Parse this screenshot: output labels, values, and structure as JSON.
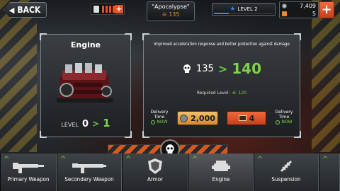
{
  "header": {
    "back_label": "BACK",
    "fuel_bars": 5,
    "car_name": "\"Apocalypse\"",
    "car_power": "135",
    "level_label": "LEVEL 2",
    "level_progress": 0.25,
    "coins": "7,409",
    "gold": "5"
  },
  "part": {
    "title": "Engine",
    "level_label": "LEVEL",
    "level_from": "0",
    "level_to": "1"
  },
  "upgrade": {
    "description": "Improved acceleration response and better protection against damage",
    "power_from": "135",
    "power_to": "140",
    "required_label": "Required Level:",
    "required_value": "120",
    "delivery_label": "Delivery Time",
    "delivery_value": "NOW",
    "price_coins": "2,000",
    "price_gold": "4"
  },
  "tabs": [
    {
      "label": "Primary Weapon"
    },
    {
      "label": "Secondary Weapon"
    },
    {
      "label": "Armor"
    },
    {
      "label": "Engine"
    },
    {
      "label": "Suspension"
    }
  ],
  "colors": {
    "accent_green": "#7ed348",
    "accent_orange": "#e5532a",
    "level_blue": "#3b8ad6"
  }
}
